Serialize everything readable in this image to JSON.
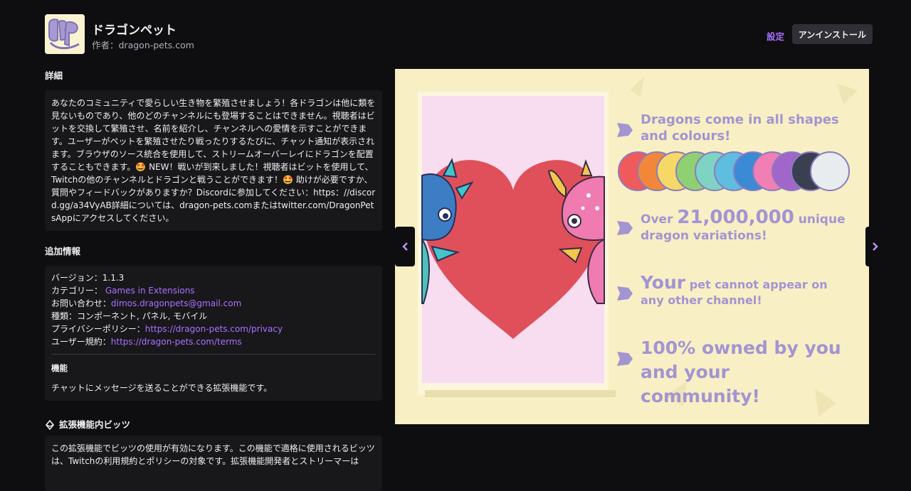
{
  "header": {
    "title": "ドラゴンペット",
    "author": "作者：dragon-pets.com",
    "settings_label": "設定",
    "uninstall_label": "アンインストール"
  },
  "details": {
    "heading": "詳細",
    "description": "あなたのコミュニティで愛らしい生き物を繁殖させましょう！各ドラゴンは他に類を見ないものであり、他のどのチャンネルにも登場することはできません。視聴者はビットを交換して繁殖させ、名前を紹介し、チャンネルへの愛情を示すことができます。ユーザーがペットを繁殖させたり戦ったりするたびに、チャット通知が表示されます。ブラウザのソース統合を使用して、ストリームオーバーレイにドラゴンを配置することもできます。🤩 NEW！戦いが到来しました！視聴者はビットを使用して、Twitchの他のチャンネルとドラゴンと戦うことができます！🤩 助けが必要ですか、質問やフィードバックがありますか？Discordに参加してください：https：//discord.gg/a34VyAB詳細については、dragon-pets.comまたはtwitter.com/DragonPetsAppにアクセスしてください。"
  },
  "additional_info": {
    "heading": "追加情報",
    "version_label": "バージョン：1.1.3",
    "category_label": "カテゴリー：",
    "category_value": "Games in Extensions",
    "contact_label": "お問い合わせ：",
    "contact_value": "dimos.dragonpets@gmail.com",
    "type_label": "種類：コンポーネント, パネル, モバイル",
    "privacy_label": "プライバシーポリシー：",
    "privacy_value": "https://dragon-pets.com/privacy",
    "terms_label": "ユーザー規約：",
    "terms_value": "https://dragon-pets.com/terms",
    "features_heading": "機能",
    "features_text": "チャットにメッセージを送ることができる拡張機能です。"
  },
  "bits": {
    "heading": "拡張機能内ビッツ",
    "text": "この拡張機能でビッツの使用が有効になります。この機能で適格に使用されるビッツは、Twitchの利用規約とポリシーの対象です。拡張機能開発者とストリーマーは"
  },
  "carousel": {
    "prev_icon": "chevron-left-icon",
    "next_icon": "chevron-right-icon",
    "slide": {
      "line1": "Dragons come in all shapes and colours!",
      "line2_pre": "Over ",
      "line2_big": "21,000,000",
      "line2_post": " unique dragon variations!",
      "line3_big": "Your",
      "line3_post": " pet cannot appear on any other channel!",
      "line4": "100% owned by you and your community!",
      "swatch_colors": [
        "#f05a5a",
        "#f2873a",
        "#f6d867",
        "#8ed072",
        "#7fd3c2",
        "#5fbde0",
        "#3a8ad6",
        "#ef7fb4",
        "#a066c9",
        "#3a3f52",
        "#e8ecef"
      ]
    }
  }
}
